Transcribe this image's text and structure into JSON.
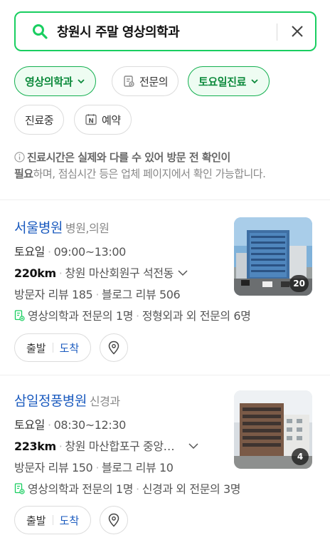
{
  "search": {
    "query": "창원시 주말 영상의학과"
  },
  "filters": {
    "row1": [
      {
        "label": "영상의학과",
        "active": true,
        "chevron": true
      },
      {
        "label": "전문의",
        "active": false,
        "icon": "doctor-doc-icon"
      },
      {
        "label": "토요일진료",
        "active": true,
        "chevron": true
      }
    ],
    "row2": [
      {
        "label": "진료중",
        "active": false
      },
      {
        "label": "예약",
        "active": false,
        "icon": "naver-n-icon"
      }
    ]
  },
  "notice": {
    "bold1": "진료시간은 실제와 다를 수 있어 방문 전 확인이",
    "bold2": "필요",
    "rest": "하며, 점심시간 등은 업체 페이지에서 확인 가능합니다."
  },
  "results": [
    {
      "name": "서울병원",
      "category": "병원,의원",
      "day": "토요일",
      "hours": "09:00~13:00",
      "distance": "220km",
      "address": "창원 마산회원구 석전동",
      "visitor_reviews": "방문자 리뷰 185",
      "blog_reviews": "블로그 리뷰 506",
      "specialists_main": "영상의학과 전문의 1명",
      "specialists_other": "정형외과 외 전문의 6명",
      "photo_count": "20",
      "depart": "출발",
      "arrive": "도착"
    },
    {
      "name": "삼일정풍병원",
      "category": "신경과",
      "day": "토요일",
      "hours": "08:30~12:30",
      "distance": "223km",
      "address": "창원 마산합포구 중앙…",
      "visitor_reviews": "방문자 리뷰 150",
      "blog_reviews": "블로그 리뷰 10",
      "specialists_main": "영상의학과 전문의 1명",
      "specialists_other": "신경과 외 전문의 3명",
      "photo_count": "4",
      "depart": "출발",
      "arrive": "도착"
    }
  ],
  "colors": {
    "brand_green": "#19ce60",
    "link_blue": "#1b5bbf"
  }
}
